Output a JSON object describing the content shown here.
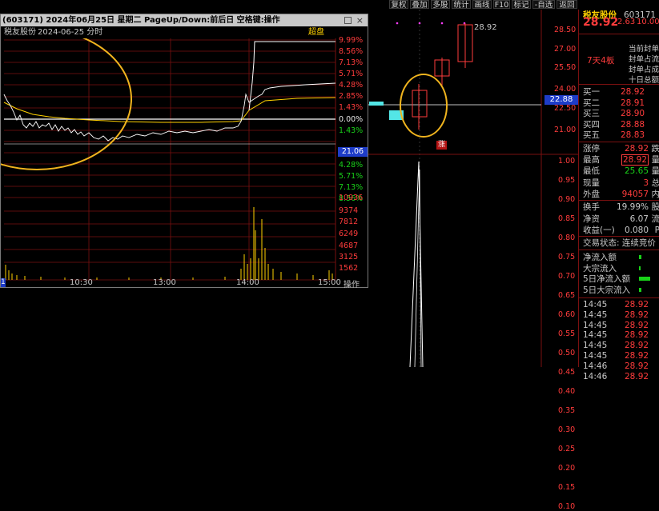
{
  "toolbar": {
    "buttons": [
      "复权",
      "叠加",
      "多股",
      "统计",
      "画线",
      "F10",
      "标记",
      "-自选",
      "返回"
    ]
  },
  "main_kline": {
    "price_labels": [
      "28.50",
      "27.00",
      "25.50",
      "24.00",
      "22.50",
      "21.00"
    ],
    "current_price_marker": "22.88",
    "high_label": "28.92",
    "badge": "涨",
    "lower_labels": [
      "1.00",
      "0.95",
      "0.90",
      "0.85",
      "0.80",
      "0.75",
      "0.70",
      "0.65",
      "0.60",
      "0.55",
      "0.50",
      "0.45",
      "0.40",
      "0.35",
      "0.30",
      "0.25",
      "0.20",
      "0.15",
      "0.10"
    ]
  },
  "popup": {
    "title": "(603171) 2024年06月25日 星期二 PageUp/Down:前后日 空格键:操作",
    "stock_name": "税友股份",
    "date_mode": "2024-06-25 分时",
    "overlay_button": "超盘",
    "pct_labels_up": [
      "9.99%",
      "8.56%",
      "7.13%",
      "5.71%",
      "4.28%",
      "2.85%",
      "1.43%"
    ],
    "pct_zero": "0.00%",
    "pct_labels_down": [
      "1.43%",
      "2.85%",
      "4.28%",
      "5.71%",
      "7.13%",
      "8.56%"
    ],
    "price_marker": "21.06",
    "volume_labels": [
      "10936",
      "9374",
      "7812",
      "6249",
      "4687",
      "3125",
      "1562"
    ],
    "time_labels": [
      "10:30",
      "13:00",
      "14:00",
      "15:00"
    ],
    "left_tick": "1",
    "operate_label": "操作"
  },
  "rpanel": {
    "stock_name": "税友股份",
    "code": "603171",
    "last": "28.92",
    "change": "2.63",
    "change_pct": "10.00%",
    "limit_info": [
      "当前封单",
      "封单占流",
      "封单占成",
      "十日总额"
    ],
    "streak": "7天4板",
    "bids": [
      {
        "label": "买一",
        "price": "28.92"
      },
      {
        "label": "买二",
        "price": "28.91"
      },
      {
        "label": "买三",
        "price": "28.90"
      },
      {
        "label": "买四",
        "price": "28.88"
      },
      {
        "label": "买五",
        "price": "28.83"
      }
    ],
    "stats": [
      {
        "label": "涨停",
        "value": "28.92",
        "tail": "跌"
      },
      {
        "label": "最高",
        "value": "28.92",
        "tail": "量"
      },
      {
        "label": "最低",
        "value": "25.65",
        "tail": "量"
      },
      {
        "label": "现量",
        "value": "3",
        "tail": "总"
      },
      {
        "label": "外盘",
        "value": "94057",
        "tail": "内"
      }
    ],
    "stats2": [
      {
        "label": "换手",
        "value": "19.99%",
        "tail": "股"
      },
      {
        "label": "净资",
        "value": "6.07",
        "tail": "流"
      },
      {
        "label": "收益(一)",
        "value": "0.080",
        "tail": "P"
      }
    ],
    "trade_status": "交易状态: 连续竞价",
    "flows": [
      "净流入额",
      "大宗流入",
      "5日净流入额",
      "5日大宗流入"
    ],
    "ticks": [
      {
        "time": "14:45",
        "price": "28.92"
      },
      {
        "time": "14:45",
        "price": "28.92"
      },
      {
        "time": "14:45",
        "price": "28.92"
      },
      {
        "time": "14:45",
        "price": "28.92"
      },
      {
        "time": "14:45",
        "price": "28.92"
      },
      {
        "time": "14:45",
        "price": "28.92"
      },
      {
        "time": "14:46",
        "price": "28.92"
      },
      {
        "time": "14:46",
        "price": "28.92"
      }
    ]
  }
}
